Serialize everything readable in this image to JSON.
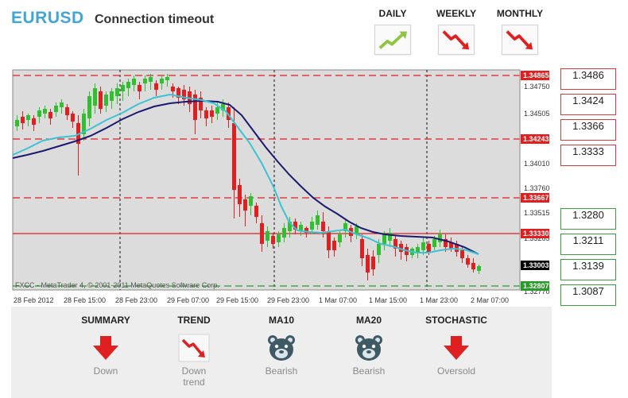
{
  "header": {
    "symbol": "EURUSD",
    "status": "Connection timeout"
  },
  "periods": [
    {
      "label": "DAILY",
      "icon": "trend-up-icon",
      "color": "#8dc63f"
    },
    {
      "label": "WEEKLY",
      "icon": "trend-down-icon",
      "color": "#e02020"
    },
    {
      "label": "MONTHLY",
      "icon": "trend-down-icon",
      "color": "#e02020"
    }
  ],
  "chart": {
    "watermark": "FXCC - MetaTrader 4, © 2001-2011 MetaQuotes Software Corp.",
    "price_scale": [
      "1.34750",
      "1.34505",
      "1.34010",
      "1.33760",
      "1.33515",
      "1.33265",
      "1.32770"
    ],
    "price_tags": {
      "top_red": "1.34865",
      "mid_red_1": "1.34243",
      "mid_red_2": "1.33667",
      "resistance": "1.33330",
      "current": "1.33003",
      "bottom_green": "1.32807"
    },
    "time_labels": [
      "28 Feb 2012",
      "28 Feb 15:00",
      "28 Feb 23:00",
      "29 Feb 07:00",
      "29 Feb 15:00",
      "29 Feb 23:00",
      "1 Mar 07:00",
      "1 Mar 15:00",
      "1 Mar 23:00",
      "2 Mar 07:00"
    ],
    "colors": {
      "bull": "#2fbf2f",
      "bear": "#e02020",
      "ma_fast": "#3cc3d3",
      "ma_slow": "#1a1a70"
    }
  },
  "levels": {
    "resistance": [
      "1.3486",
      "1.3424",
      "1.3366",
      "1.3333"
    ],
    "support": [
      "1.3280",
      "1.3211",
      "1.3139",
      "1.3087"
    ]
  },
  "indicators": [
    {
      "title": "SUMMARY",
      "icon": "down-arrow-icon",
      "value": "Down"
    },
    {
      "title": "TREND",
      "icon": "trend-down-icon",
      "value": "Down trend"
    },
    {
      "title": "MA10",
      "icon": "bear-icon",
      "value": "Bearish"
    },
    {
      "title": "MA20",
      "icon": "bear-icon",
      "value": "Bearish"
    },
    {
      "title": "STOCHASTIC",
      "icon": "down-arrow-icon",
      "value": "Oversold"
    }
  ]
}
